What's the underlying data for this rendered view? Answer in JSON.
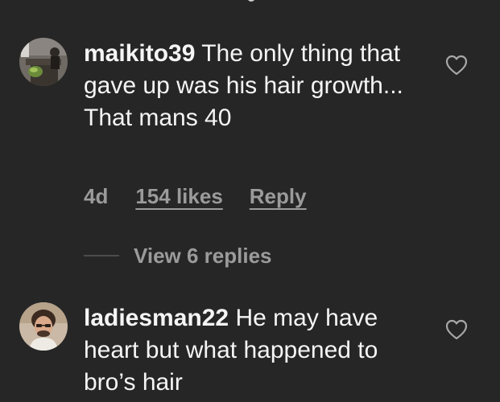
{
  "comments": [
    {
      "username": "maikito39",
      "text": "The only thing that gave up was his hair growth... That mans 40",
      "age": "4d",
      "likes": "154 likes",
      "reply": "Reply",
      "view_replies": "View 6 replies"
    },
    {
      "username": "ladiesman22",
      "text": "He may have heart but what happened to bro’s hair"
    }
  ],
  "colors": {
    "background": "#262626",
    "primary_text": "#f5f5f5",
    "secondary_text": "#9b9b9b",
    "heart_outline": "#a8a8a8"
  },
  "icons": {
    "like": "heart-outline-icon"
  }
}
